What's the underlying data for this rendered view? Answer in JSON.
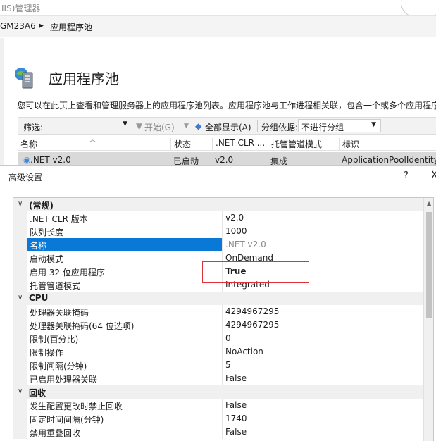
{
  "window": {
    "title": "IIS)管理器"
  },
  "address": {
    "server": "GM23A6",
    "page": "应用程序池"
  },
  "main": {
    "title": "应用程序池",
    "description": "您可以在此页上查看和管理服务器上的应用程序池列表。应用程序池与工作进程相关联，包含一个或多个应用程序"
  },
  "toolbar": {
    "filter_label": "筛选:",
    "go_label": "开始(G)",
    "show_all_label": "全部显示(A)",
    "group_label": "分组依据:",
    "group_value": "不进行分组"
  },
  "grid": {
    "columns": [
      "名称",
      "状态",
      ".NET CLR ...",
      "托管管道模式",
      "标识"
    ],
    "row": {
      "name": ".NET v2.0",
      "status": "已启动",
      "clr": "v2.0",
      "pipeline": "集成",
      "identity": "ApplicationPoolIdentity"
    }
  },
  "dialog": {
    "title": "高级设置",
    "help": "?",
    "close": "X",
    "sections": [
      {
        "category": "(常规)",
        "rows": [
          {
            "name": ".NET CLR 版本",
            "value": "v2.0"
          },
          {
            "name": "队列长度",
            "value": "1000"
          },
          {
            "name": "名称",
            "value": ".NET v2.0"
          },
          {
            "name": "启动模式",
            "value": "OnDemand"
          },
          {
            "name": "启用 32 位应用程序",
            "value": "True"
          },
          {
            "name": "托管管道模式",
            "value": "Integrated"
          }
        ]
      },
      {
        "category": "CPU",
        "rows": [
          {
            "name": "处理器关联掩码",
            "value": "4294967295"
          },
          {
            "name": "处理器关联掩码(64 位选项)",
            "value": "4294967295"
          },
          {
            "name": "限制(百分比)",
            "value": "0"
          },
          {
            "name": "限制操作",
            "value": "NoAction"
          },
          {
            "name": "限制间隔(分钟)",
            "value": "5"
          },
          {
            "name": "已启用处理器关联",
            "value": "False"
          }
        ]
      },
      {
        "category": "回收",
        "rows": [
          {
            "name": "发生配置更改时禁止回收",
            "value": "False"
          },
          {
            "name": "固定时间间隔(分钟)",
            "value": "1740"
          },
          {
            "name": "禁用重叠回收",
            "value": "False"
          }
        ]
      }
    ]
  },
  "colors": {
    "selection": "#0a78d7",
    "highlight_box": "#e0303a"
  }
}
